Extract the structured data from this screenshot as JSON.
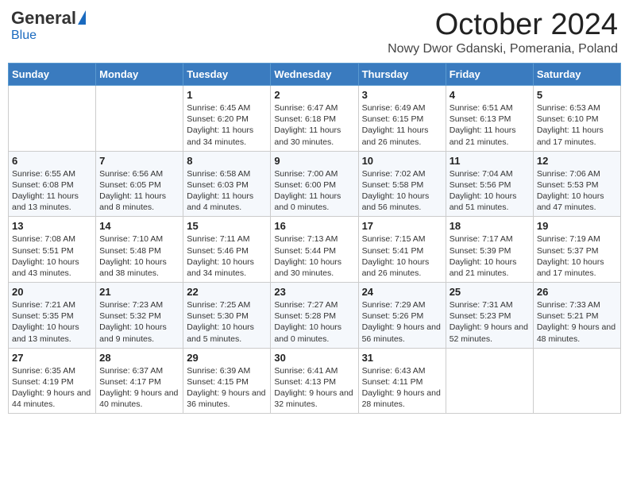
{
  "logo": {
    "general": "General",
    "blue": "Blue"
  },
  "title": "October 2024",
  "subtitle": "Nowy Dwor Gdanski, Pomerania, Poland",
  "days_of_week": [
    "Sunday",
    "Monday",
    "Tuesday",
    "Wednesday",
    "Thursday",
    "Friday",
    "Saturday"
  ],
  "weeks": [
    [
      {
        "day": "",
        "info": ""
      },
      {
        "day": "",
        "info": ""
      },
      {
        "day": "1",
        "info": "Sunrise: 6:45 AM\nSunset: 6:20 PM\nDaylight: 11 hours\nand 34 minutes."
      },
      {
        "day": "2",
        "info": "Sunrise: 6:47 AM\nSunset: 6:18 PM\nDaylight: 11 hours\nand 30 minutes."
      },
      {
        "day": "3",
        "info": "Sunrise: 6:49 AM\nSunset: 6:15 PM\nDaylight: 11 hours\nand 26 minutes."
      },
      {
        "day": "4",
        "info": "Sunrise: 6:51 AM\nSunset: 6:13 PM\nDaylight: 11 hours\nand 21 minutes."
      },
      {
        "day": "5",
        "info": "Sunrise: 6:53 AM\nSunset: 6:10 PM\nDaylight: 11 hours\nand 17 minutes."
      }
    ],
    [
      {
        "day": "6",
        "info": "Sunrise: 6:55 AM\nSunset: 6:08 PM\nDaylight: 11 hours\nand 13 minutes."
      },
      {
        "day": "7",
        "info": "Sunrise: 6:56 AM\nSunset: 6:05 PM\nDaylight: 11 hours\nand 8 minutes."
      },
      {
        "day": "8",
        "info": "Sunrise: 6:58 AM\nSunset: 6:03 PM\nDaylight: 11 hours\nand 4 minutes."
      },
      {
        "day": "9",
        "info": "Sunrise: 7:00 AM\nSunset: 6:00 PM\nDaylight: 11 hours\nand 0 minutes."
      },
      {
        "day": "10",
        "info": "Sunrise: 7:02 AM\nSunset: 5:58 PM\nDaylight: 10 hours\nand 56 minutes."
      },
      {
        "day": "11",
        "info": "Sunrise: 7:04 AM\nSunset: 5:56 PM\nDaylight: 10 hours\nand 51 minutes."
      },
      {
        "day": "12",
        "info": "Sunrise: 7:06 AM\nSunset: 5:53 PM\nDaylight: 10 hours\nand 47 minutes."
      }
    ],
    [
      {
        "day": "13",
        "info": "Sunrise: 7:08 AM\nSunset: 5:51 PM\nDaylight: 10 hours\nand 43 minutes."
      },
      {
        "day": "14",
        "info": "Sunrise: 7:10 AM\nSunset: 5:48 PM\nDaylight: 10 hours\nand 38 minutes."
      },
      {
        "day": "15",
        "info": "Sunrise: 7:11 AM\nSunset: 5:46 PM\nDaylight: 10 hours\nand 34 minutes."
      },
      {
        "day": "16",
        "info": "Sunrise: 7:13 AM\nSunset: 5:44 PM\nDaylight: 10 hours\nand 30 minutes."
      },
      {
        "day": "17",
        "info": "Sunrise: 7:15 AM\nSunset: 5:41 PM\nDaylight: 10 hours\nand 26 minutes."
      },
      {
        "day": "18",
        "info": "Sunrise: 7:17 AM\nSunset: 5:39 PM\nDaylight: 10 hours\nand 21 minutes."
      },
      {
        "day": "19",
        "info": "Sunrise: 7:19 AM\nSunset: 5:37 PM\nDaylight: 10 hours\nand 17 minutes."
      }
    ],
    [
      {
        "day": "20",
        "info": "Sunrise: 7:21 AM\nSunset: 5:35 PM\nDaylight: 10 hours\nand 13 minutes."
      },
      {
        "day": "21",
        "info": "Sunrise: 7:23 AM\nSunset: 5:32 PM\nDaylight: 10 hours\nand 9 minutes."
      },
      {
        "day": "22",
        "info": "Sunrise: 7:25 AM\nSunset: 5:30 PM\nDaylight: 10 hours\nand 5 minutes."
      },
      {
        "day": "23",
        "info": "Sunrise: 7:27 AM\nSunset: 5:28 PM\nDaylight: 10 hours\nand 0 minutes."
      },
      {
        "day": "24",
        "info": "Sunrise: 7:29 AM\nSunset: 5:26 PM\nDaylight: 9 hours\nand 56 minutes."
      },
      {
        "day": "25",
        "info": "Sunrise: 7:31 AM\nSunset: 5:23 PM\nDaylight: 9 hours\nand 52 minutes."
      },
      {
        "day": "26",
        "info": "Sunrise: 7:33 AM\nSunset: 5:21 PM\nDaylight: 9 hours\nand 48 minutes."
      }
    ],
    [
      {
        "day": "27",
        "info": "Sunrise: 6:35 AM\nSunset: 4:19 PM\nDaylight: 9 hours\nand 44 minutes."
      },
      {
        "day": "28",
        "info": "Sunrise: 6:37 AM\nSunset: 4:17 PM\nDaylight: 9 hours\nand 40 minutes."
      },
      {
        "day": "29",
        "info": "Sunrise: 6:39 AM\nSunset: 4:15 PM\nDaylight: 9 hours\nand 36 minutes."
      },
      {
        "day": "30",
        "info": "Sunrise: 6:41 AM\nSunset: 4:13 PM\nDaylight: 9 hours\nand 32 minutes."
      },
      {
        "day": "31",
        "info": "Sunrise: 6:43 AM\nSunset: 4:11 PM\nDaylight: 9 hours\nand 28 minutes."
      },
      {
        "day": "",
        "info": ""
      },
      {
        "day": "",
        "info": ""
      }
    ]
  ]
}
